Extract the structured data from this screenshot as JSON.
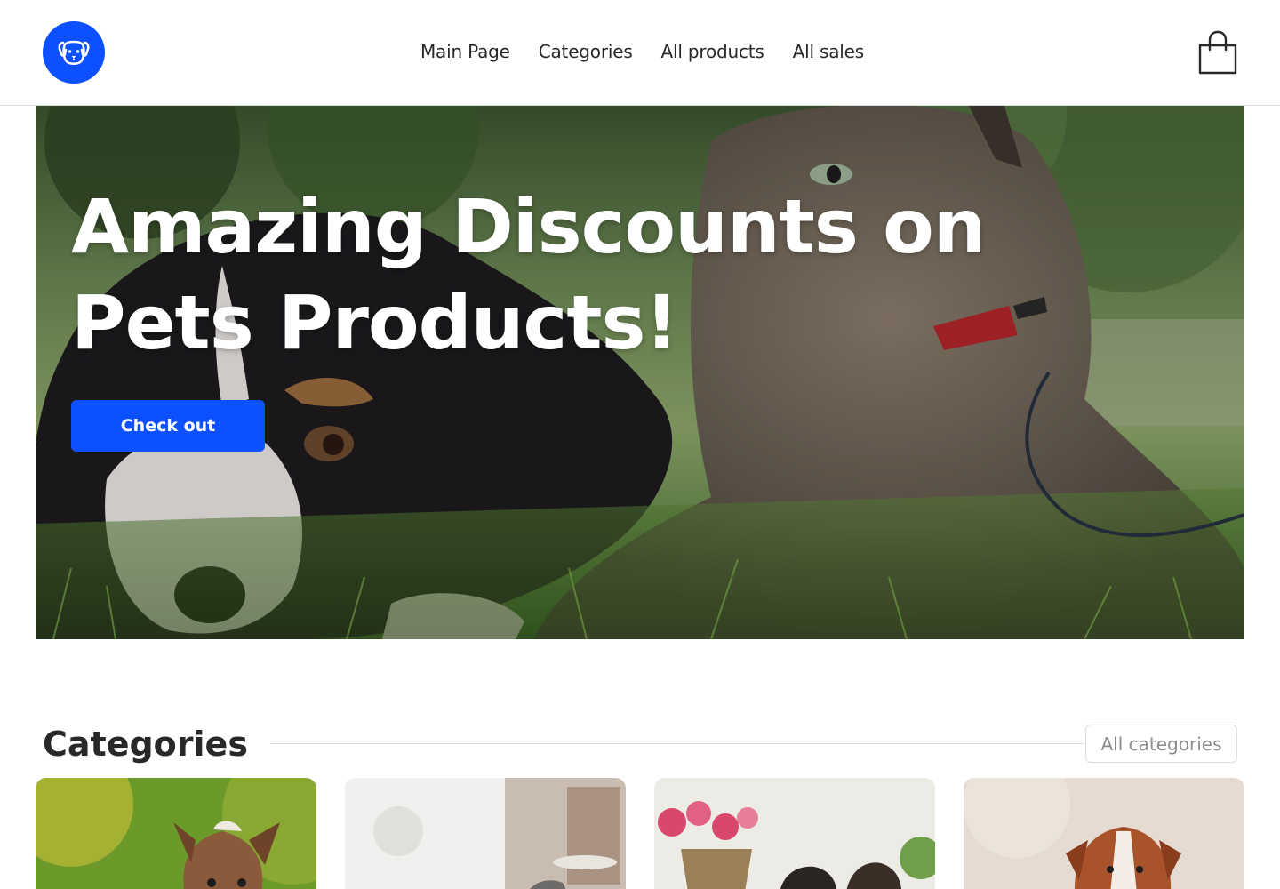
{
  "header": {
    "logo_icon": "dog-face-icon",
    "nav": [
      {
        "label": "Main Page"
      },
      {
        "label": "Categories"
      },
      {
        "label": "All products"
      },
      {
        "label": "All sales"
      }
    ],
    "cart_icon": "shopping-bag-icon"
  },
  "hero": {
    "title": "Amazing Discounts on Pets Products!",
    "button_label": "Check out"
  },
  "categories": {
    "title": "Categories",
    "all_button_label": "All categories",
    "cards": [
      {
        "image": "dog-on-green-grass"
      },
      {
        "image": "cat-in-bright-room"
      },
      {
        "image": "dogs-with-flowers"
      },
      {
        "image": "dog-on-sand"
      }
    ]
  },
  "colors": {
    "accent": "#0d50ff",
    "text": "#282828",
    "muted": "#8b8b8b",
    "divider": "#dddddd"
  }
}
